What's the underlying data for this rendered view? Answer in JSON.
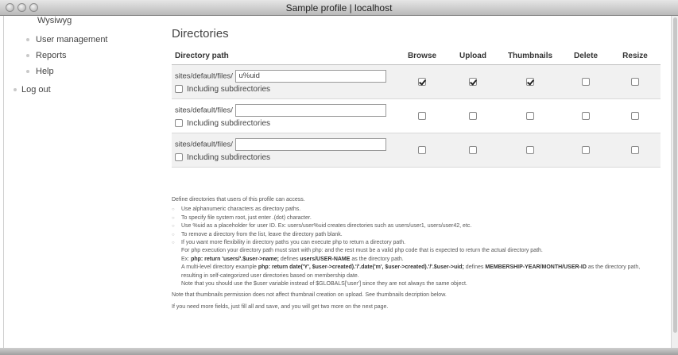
{
  "window": {
    "title": "Sample profile | localhost"
  },
  "sidebar": {
    "items": [
      {
        "label": "Wysiwyg"
      },
      {
        "label": "User management"
      },
      {
        "label": "Reports"
      },
      {
        "label": "Help"
      },
      {
        "label": "Log out"
      }
    ]
  },
  "main": {
    "heading": "Directories",
    "columns": [
      "Directory path",
      "Browse",
      "Upload",
      "Thumbnails",
      "Delete",
      "Resize"
    ],
    "rows": [
      {
        "prefix": "sites/default/files/",
        "value": "u%uid",
        "subdir_label": "Including subdirectories",
        "subdir": false,
        "browse": true,
        "upload": true,
        "thumbnails": true,
        "delete": false,
        "resize": false
      },
      {
        "prefix": "sites/default/files/",
        "value": "",
        "subdir_label": "Including subdirectories",
        "subdir": false,
        "browse": false,
        "upload": false,
        "thumbnails": false,
        "delete": false,
        "resize": false
      },
      {
        "prefix": "sites/default/files/",
        "value": "",
        "subdir_label": "Including subdirectories",
        "subdir": false,
        "browse": false,
        "upload": false,
        "thumbnails": false,
        "delete": false,
        "resize": false
      }
    ]
  },
  "help": {
    "intro": "Define directories that users of this profile can access.",
    "b1": "Use alphanumeric characters as directory paths.",
    "b2": "To specify file system root, just enter .(dot) character.",
    "b3": "Use %uid as a placeholder for user ID. Ex: users/user%uid creates directories such as users/user1, users/user42, etc.",
    "b4": "To remove a directory from the list, leave the directory path blank.",
    "b5": "If you want more flexibility in directory paths you can execute php to return a directory path.",
    "b5_l2": "For php execution your directory path must start with php: and the rest must be a valid php code that is expected to return the actual directory path.",
    "ex1_a": "Ex: ",
    "ex1_code": "php: return 'users/'.$user->name;",
    "ex1_b": " defines ",
    "ex1_path": "users/USER-NAME",
    "ex1_c": " as the directory path.",
    "ex2_a": "A multi-level directory example ",
    "ex2_code": "php: return date('Y', $user->created).'/'.date('m', $user->created).'/'.$user->uid;",
    "ex2_b": " defines ",
    "ex2_path": "MEMBERSHIP-YEAR/MONTH/USER-ID",
    "ex2_c": " as the directory path, resulting in self-categorized user directories based on membership date.",
    "ex3": "Note that you should use the $user variable instead of $GLOBALS['user'] since they are not always the same object.",
    "note": "Note that thumbnails permission does not affect thumbnail creation on upload. See thumbnails decription below.",
    "more": "If you need more fields, just fill all and save, and you will get two more on the next page."
  }
}
